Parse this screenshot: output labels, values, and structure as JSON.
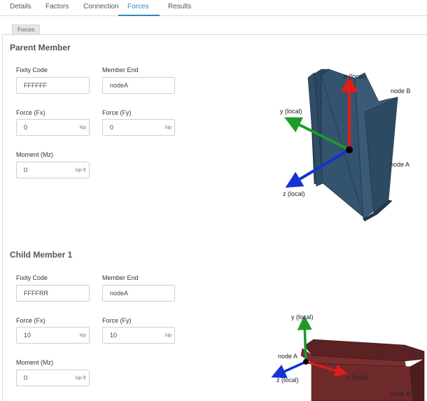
{
  "tabs": [
    "Details",
    "Factors",
    "Connection",
    "Forces",
    "Results"
  ],
  "active_tab": "Forces",
  "subtab": "Forces",
  "parent": {
    "title": "Parent Member",
    "fixity_label": "Fixity Code",
    "fixity_value": "FFFFFF",
    "end_label": "Member End",
    "end_value": "nodeA",
    "fx_label": "Force (Fx)",
    "fx_value": "0",
    "fx_unit": "kip",
    "fy_label": "Force (Fy)",
    "fy_value": "0",
    "fy_unit": "kip",
    "mz_label": "Moment (Mz)",
    "mz_value": "0",
    "mz_unit": "kip-ft",
    "diagram": {
      "x_label": "x (local)",
      "y_label": "y (local)",
      "z_label": "z (local)",
      "node_b": "node B",
      "node_a": "node A",
      "member_color": "#2f4d66",
      "x_color": "#e21b1b",
      "y_color": "#1e9a2a",
      "z_color": "#1432d6"
    }
  },
  "child": {
    "title": "Child Member 1",
    "fixity_label": "Fixity Code",
    "fixity_value": "FFFFRR",
    "end_label": "Member End",
    "end_value": "nodeA",
    "fx_label": "Force (Fx)",
    "fx_value": "10",
    "fx_unit": "kip",
    "fy_label": "Force (Fy)",
    "fy_value": "10",
    "fy_unit": "kip",
    "mz_label": "Moment (Mz)",
    "mz_value": "0",
    "mz_unit": "kip-ft",
    "diagram": {
      "x_label": "x (local)",
      "y_label": "y (local)",
      "z_label": "z (local)",
      "node_a": "node A",
      "node_b": "node B",
      "member_color": "#6e2a2a",
      "x_color": "#e21b1b",
      "y_color": "#1e9a2a",
      "z_color": "#1432d6"
    }
  }
}
